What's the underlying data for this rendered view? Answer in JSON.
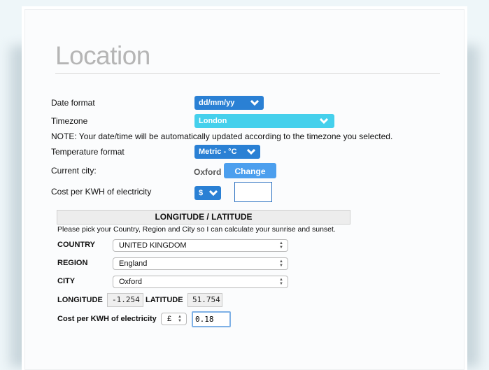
{
  "title": "Location",
  "date_format": {
    "label": "Date format",
    "value": "dd/mm/yy"
  },
  "timezone": {
    "label": "Timezone",
    "value": "London"
  },
  "note": "NOTE: Your date/time will be automatically updated according to the timezone you selected.",
  "temperature": {
    "label": "Temperature format",
    "value": "Metric - °C"
  },
  "current_city": {
    "label": "Current city:",
    "value": "Oxford",
    "button": "Change"
  },
  "cost": {
    "label": "Cost per KWH of electricity",
    "currency": "$",
    "value": ""
  },
  "lonlat": {
    "heading": "LONGITUDE / LATITUDE",
    "instructions": "Please pick your Country, Region and City so I can calculate your sunrise and sunset.",
    "country_label": "COUNTRY",
    "country": "UNITED KINGDOM",
    "region_label": "REGION",
    "region": "England",
    "city_label": "CITY",
    "city": "Oxford",
    "longitude_label": "LONGITUDE",
    "longitude": "-1.254",
    "latitude_label": "LATITUDE",
    "latitude": "51.754",
    "cost_label": "Cost per KWH of electricity",
    "currency": "£",
    "cost": "0.18"
  },
  "colors": {
    "accent": "#2a80d4",
    "timezone": "#45d0ec",
    "button": "#4c9fee"
  }
}
